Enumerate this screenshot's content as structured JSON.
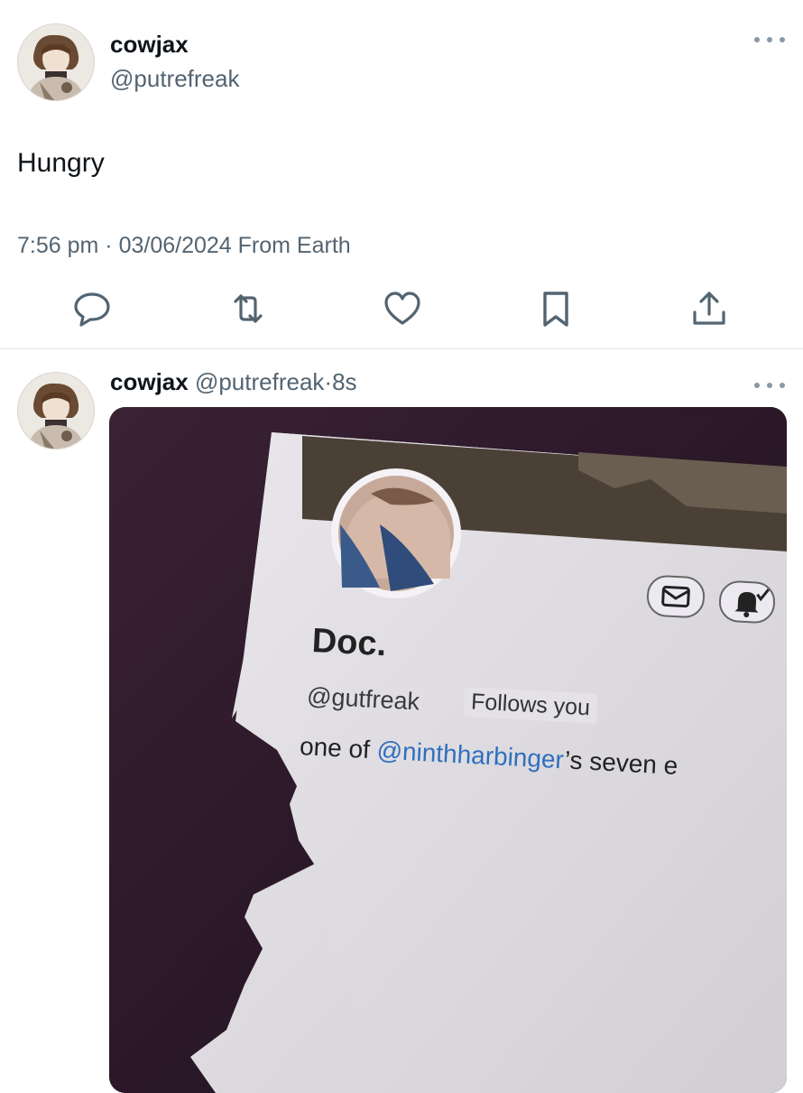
{
  "post1": {
    "author_name": "cowjax",
    "author_handle": "@putrefreak",
    "text": "Hungry",
    "time": "7:56 pm",
    "separator": "·",
    "date": "03/06/2024",
    "source": "From Earth",
    "actions": [
      "reply-icon",
      "retweet-icon",
      "like-icon",
      "bookmark-icon",
      "share-icon"
    ]
  },
  "post2": {
    "author_name": "cowjax",
    "author_handle": "@putrefreak",
    "separator": "·",
    "time": "8s",
    "photo": {
      "profile_name": "Doc.",
      "profile_handle": "@gutfreak",
      "follows_badge": "Follows you",
      "bio_prefix": "one of ",
      "bio_mention": "@ninthharbinger",
      "bio_suffix": "’s seven e",
      "buttons": [
        "mail-icon",
        "bell-icon"
      ]
    }
  },
  "colors": {
    "text_primary": "#0f1419",
    "text_secondary": "#536471",
    "mention_blue": "#2f6fbf",
    "divider": "#e1e5e8"
  }
}
